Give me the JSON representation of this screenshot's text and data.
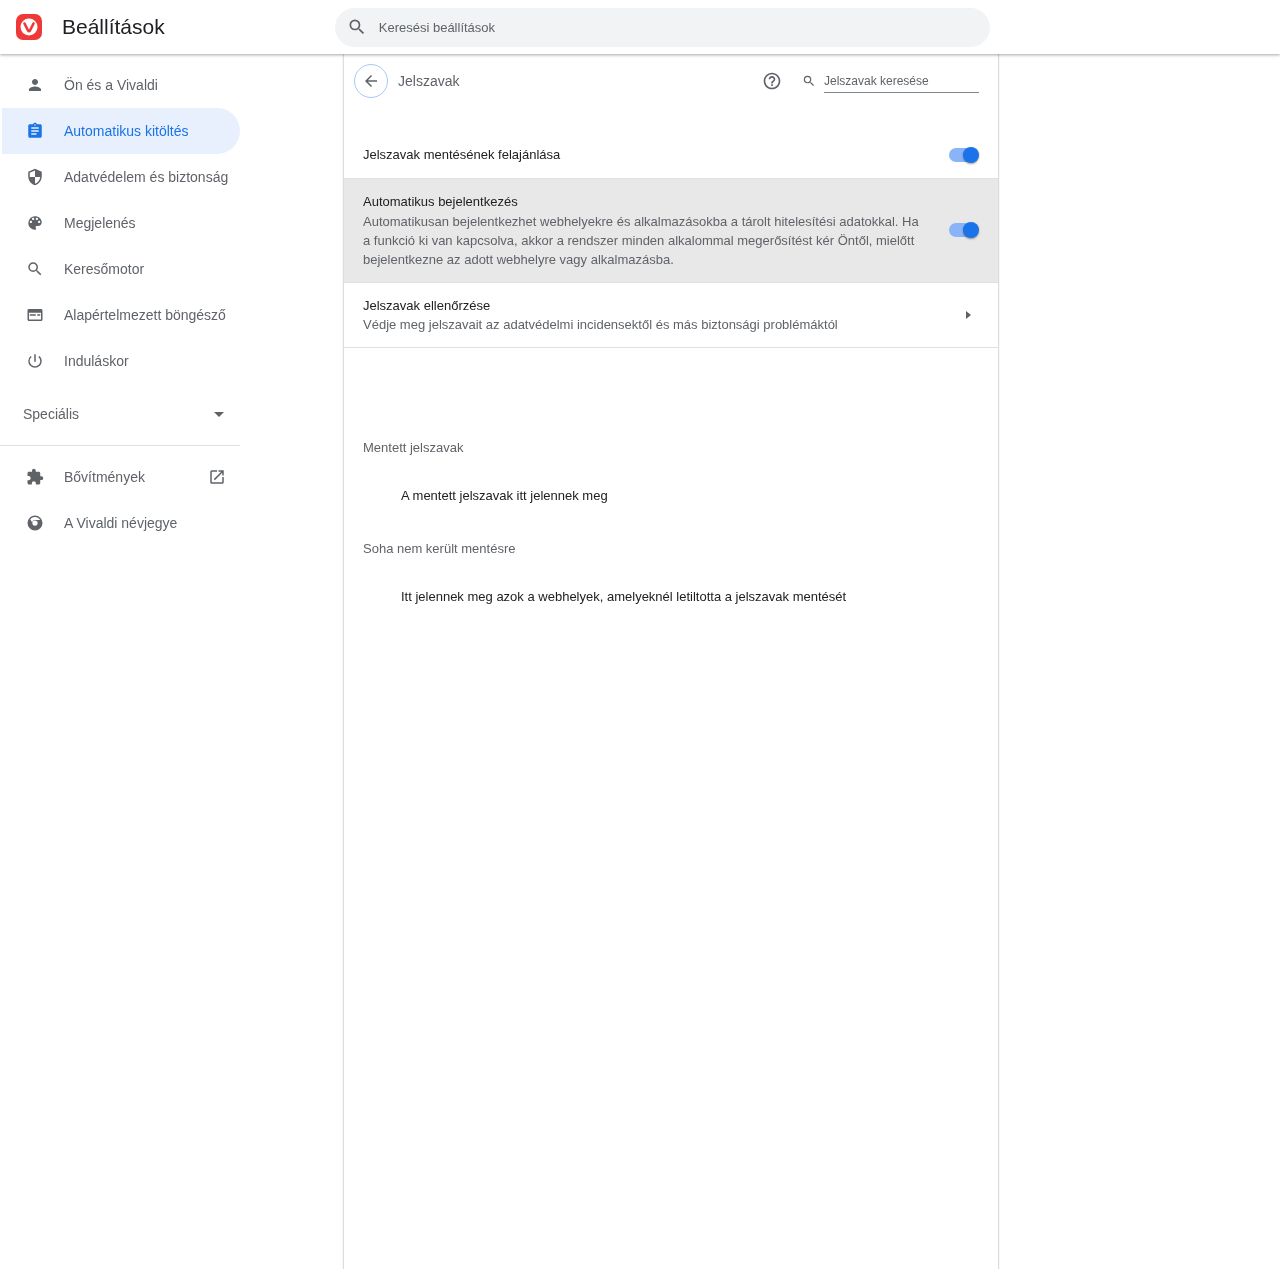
{
  "header": {
    "title": "Beállítások",
    "search": {
      "placeholder": "Keresési beállítások"
    }
  },
  "sidebar": {
    "items": [
      {
        "label": "Ön és a Vivaldi",
        "selected": false
      },
      {
        "label": "Automatikus kitöltés",
        "selected": true
      },
      {
        "label": "Adatvédelem és biztonság",
        "selected": false
      },
      {
        "label": "Megjelenés",
        "selected": false
      },
      {
        "label": "Keresőmotor",
        "selected": false
      },
      {
        "label": "Alapértelmezett böngésző",
        "selected": false
      },
      {
        "label": "Induláskor",
        "selected": false
      }
    ],
    "advanced": {
      "label": "Speciális",
      "expanded": false
    },
    "links": [
      {
        "label": "Bővítmények",
        "external": true
      },
      {
        "label": "A Vivaldi névjegye",
        "external": false
      }
    ]
  },
  "page": {
    "title": "Jelszavak",
    "search": {
      "placeholder": "Jelszavak keresése"
    },
    "rows": [
      {
        "kind": "toggle",
        "title": "Jelszavak mentésének felajánlása",
        "on": true,
        "hovered": false
      },
      {
        "kind": "toggle",
        "title": "Automatikus bejelentkezés",
        "description": "Automatikusan bejelentkezhet webhelyekre és alkalmazásokba a tárolt hitelesítési adatokkal. Ha a funkció ki van kapcsolva, akkor a rendszer minden alkalommal megerősítést kér Öntől, mielőtt bejelentkezne az adott webhelyre vagy alkalmazásba.",
        "on": true,
        "hovered": true
      },
      {
        "kind": "link",
        "title": "Jelszavak ellenőrzése",
        "description": "Védje meg jelszavait az adatvédelmi incidensektől és más biztonsági problémáktól",
        "hovered": false
      }
    ],
    "sections": [
      {
        "heading": "Mentett jelszavak",
        "empty_text": "A mentett jelszavak itt jelennek meg"
      },
      {
        "heading": "Soha nem került mentésre",
        "empty_text": "Itt jelennek meg azok a webhelyek, amelyeknél letiltotta a jelszavak mentését"
      }
    ]
  }
}
